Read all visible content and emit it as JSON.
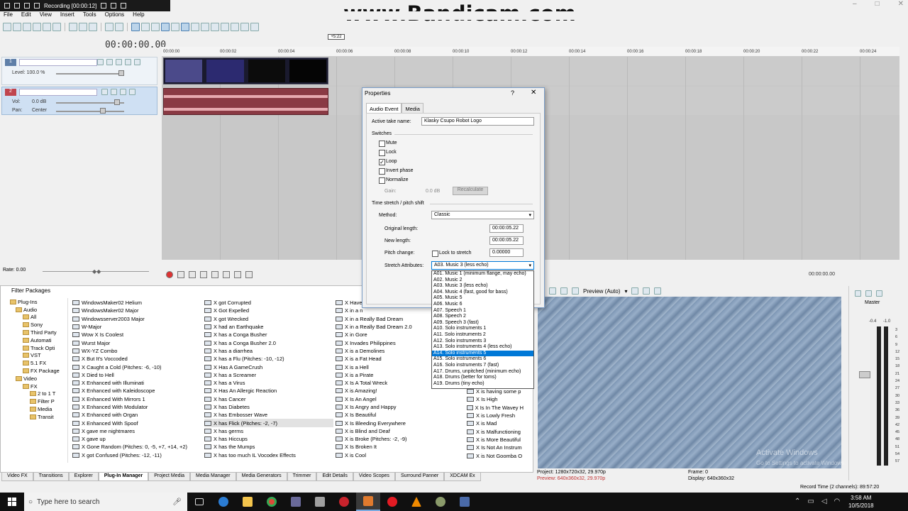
{
  "recorder": {
    "status": "Recording [00:00:12]"
  },
  "watermark": "www.Bandicam.com",
  "menu": [
    "File",
    "Edit",
    "View",
    "Insert",
    "Tools",
    "Options",
    "Help"
  ],
  "timecode": "00:00:00.00",
  "cursor_marker": "+5:22",
  "ruler_ticks": [
    "00:00:00",
    "00:00:02",
    "00:00:04",
    "00:00:06",
    "00:00:08",
    "00:00:10",
    "00:00:12",
    "00:00:14",
    "00:00:16",
    "00:00:18",
    "00:00:20",
    "00:00:22",
    "00:00:24"
  ],
  "tracks": {
    "video": {
      "number": "1",
      "level_label": "Level: 100.0 %"
    },
    "audio": {
      "number": "2",
      "vol_label": "Vol:",
      "vol_value": "0.0 dB",
      "pan_label": "Pan:",
      "pan_value": "Center"
    }
  },
  "rate": "Rate: 0.00",
  "end_time": "00:00:00.00",
  "plugins": {
    "header": "Filter Packages",
    "tree": [
      "Plug-Ins",
      "Audio",
      "All",
      "Sony",
      "Third Party",
      "Automati",
      "Track Opti",
      "VST",
      "5.1 FX",
      "FX Package",
      "Video",
      "FX",
      "2 to 1 T",
      "Filter P",
      "Media",
      "Transit"
    ],
    "col1": [
      "WindowsMaker02 Helium",
      "WindowsMaker02 Major",
      "Windowsserver2003 Major",
      "W-Major",
      "Wow X Is Coolest",
      "Wurst Major",
      "WX-YZ Combo",
      "X But It's Voccoded",
      "X Caught a Cold (Pitches: -6, -10)",
      "X Died to Hell",
      "X Enhanced with Illuminati",
      "X Enhanced with Kaleidoscope",
      "X Enhanced With Mirrors 1",
      "X Enhanced With Modulator",
      "X Enhanced with Organ",
      "X Enhanced With Spoof",
      "X gave me nightmares",
      "X gave up",
      "X Gone Random (Pitches: 0, -5, +7, +14, +2)",
      "X got Confused (Pitches: -12, -11)"
    ],
    "col2": [
      "X got Corrupted",
      "X Got Expelled",
      "X got Wrecked",
      "X had an Earthquake",
      "X has a Conga Busher",
      "X has a Conga Busher 2.0",
      "X has a diarrhea",
      "X has a Flu (Pitches: -10, -12)",
      "X Has A GameCrush",
      "X has a Screamer",
      "X has a Virus",
      "X Has An Allergic Reaction",
      "X has Cancer",
      "X has Diabetes",
      "X has Embosser Wave",
      "X has Flick (Pitches: -2, -7)",
      "X has germs",
      "X has Hiccups",
      "X has the Mumps",
      "X has too much IL Vocodex Effects"
    ],
    "col3": [
      "X Have",
      "X in a n",
      "X in a Really Bad Dream",
      "X in a Really Bad Dream 2.0",
      "X in Gore",
      "X Invades Philippines",
      "X is a Demolines",
      "X is a Fat Head",
      "X is a Hell",
      "X is a Pirate",
      "X Is A Total Wreck",
      "X is Amazing!",
      "X Is An Angel",
      "X Is Angry and Happy",
      "X Is Beautiful",
      "X Is Bleeding Everywhere",
      "X is Blind and Deaf",
      "X is Broke (Pitches: -2, -9)",
      "X Is Broken It",
      "X is Cool"
    ],
    "col4": [
      "X is having some p",
      "X Is High",
      "X Is In The Wavey H",
      "X is Lowly Fresh",
      "X is Mad",
      "X is Malfunctioning",
      "X is More Beautiful",
      "X Is Not An Instrum",
      "X is Not Goomba O"
    ]
  },
  "tabs": [
    "Video FX",
    "Transitions",
    "Explorer",
    "Plug-In Manager",
    "Project Media",
    "Media Manager",
    "Media Generators",
    "Trimmer",
    "Edit Details",
    "Video Scopes",
    "Surround Panner",
    "XDCAM Ex"
  ],
  "preview": {
    "mode": "Preview (Auto)",
    "project": "Project:  1280x720x32, 29.970p",
    "preview_line": "Preview:  640x360x32, 29.970p",
    "frame": "Frame:    0",
    "display": "Display:  640x360x32",
    "activate": "Activate Windows",
    "activate_sub": "Go to Settings to activate Windows."
  },
  "master": {
    "label": "Master",
    "left": "-0.4",
    "right": "-1.0",
    "scale": [
      "3",
      "6",
      "9",
      "12",
      "15",
      "18",
      "21",
      "24",
      "27",
      "30",
      "33",
      "36",
      "39",
      "42",
      "45",
      "48",
      "51",
      "54",
      "57"
    ]
  },
  "record_time": "Record Time (2 channels): 89:57:20",
  "dialog": {
    "title": "Properties",
    "help": "?",
    "close": "✕",
    "tabs": [
      "Audio Event",
      "Media"
    ],
    "active_take_label": "Active take name:",
    "active_take_value": "Klasky Csupo Robot Logo",
    "switches_label": "Switches",
    "switches": [
      {
        "label": "Mute",
        "checked": false
      },
      {
        "label": "Lock",
        "checked": false
      },
      {
        "label": "Loop",
        "checked": true
      },
      {
        "label": "Invert phase",
        "checked": false
      },
      {
        "label": "Normalize",
        "checked": false
      }
    ],
    "gain_label": "Gain:",
    "gain_value": "0.0 dB",
    "recalculate": "Recalculate",
    "stretch_label": "Time stretch / pitch shift",
    "method_label": "Method:",
    "method_value": "Classic",
    "original_length_label": "Original length:",
    "original_length_value": "00:00:05.22",
    "new_length_label": "New length:",
    "new_length_value": "00:00:05.22",
    "pitch_change_label": "Pitch change:",
    "lock_to_stretch": "Lock to stretch",
    "pitch_value": "0.00000",
    "stretch_attr_label": "Stretch Attributes:",
    "stretch_attr_value": "A03. Music 3 (less echo)",
    "options": [
      "A01. Music 1 (minimum flange, may echo)",
      "A02. Music 2",
      "A03. Music 3 (less echo)",
      "A04. Music 4 (fast, good for bass)",
      "A05. Music 5",
      "A06. Music 6",
      "A07. Speech 1",
      "A08. Speech 2",
      "A09. Speech 3 (fast)",
      "A10. Solo instruments 1",
      "A11. Solo instruments 2",
      "A12. Solo instruments 3",
      "A13. Solo instruments 4 (less echo)",
      "A14. Solo instruments 5",
      "A15. Solo instruments 6",
      "A16. Solo instruments 7 (fast)",
      "A17. Drums, unpitched (minimum echo)",
      "A18. Drums (better for toms)",
      "A19. Drums (tiny echo)"
    ],
    "selected_option_index": 13
  },
  "taskbar": {
    "search_placeholder": "Type here to search",
    "time": "3:58 AM",
    "date": "10/5/2018"
  }
}
